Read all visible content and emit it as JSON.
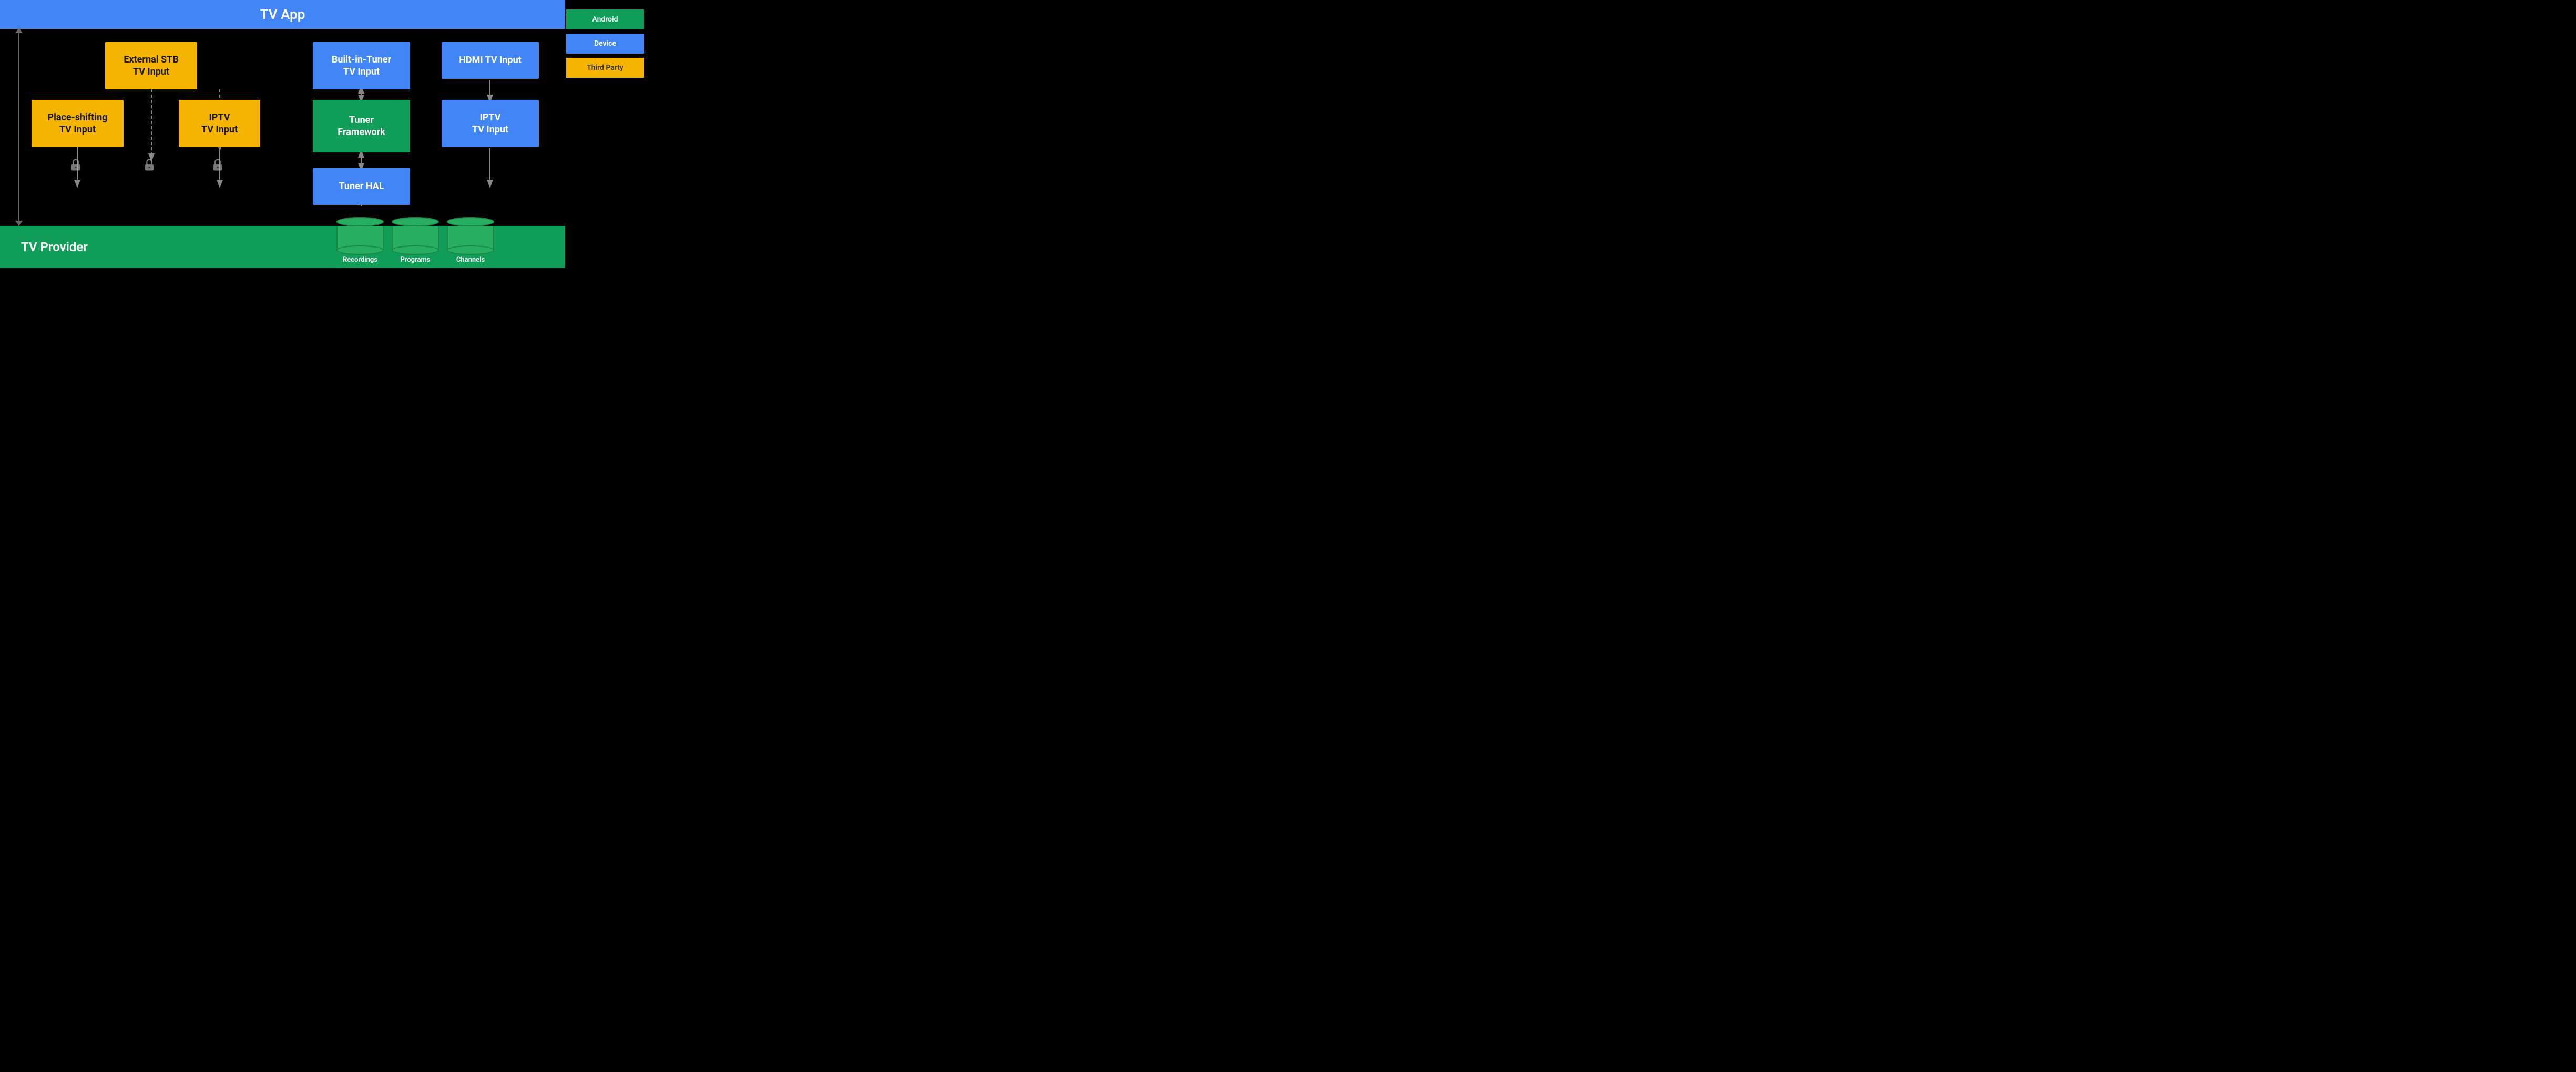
{
  "header": {
    "title": "TV App"
  },
  "footer": {
    "title": "TV Provider"
  },
  "legend": {
    "android_label": "Android",
    "device_label": "Device",
    "third_party_label": "Third Party"
  },
  "boxes": {
    "ext_stb": "External STB\nTV Input",
    "place_shifting": "Place-shifting\nTV Input",
    "iptv_left": "IPTV\nTV Input",
    "builtin": "Built-in-Tuner\nTV Input",
    "tuner_fw": "Tuner\nFramework",
    "tuner_hal": "Tuner HAL",
    "hdmi": "HDMI TV Input",
    "iptv_right": "IPTV\nTV Input"
  },
  "cylinders": {
    "recordings": "Recordings",
    "programs": "Programs",
    "channels": "Channels"
  }
}
